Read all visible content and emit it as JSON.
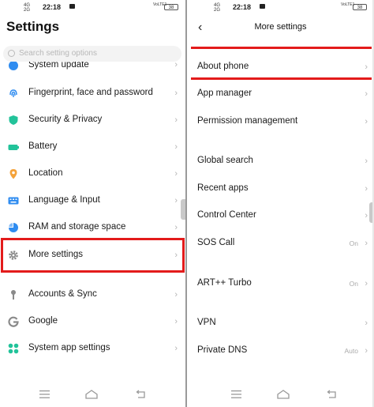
{
  "status": {
    "net_left": "4G\n2G",
    "time": "22:18",
    "signal": "VoLTE1",
    "battery": "38"
  },
  "left": {
    "title": "Settings",
    "search_placeholder": "Search setting options",
    "items": [
      {
        "label": "System update",
        "icon": "system-update-icon",
        "color": "#2f8cf0"
      },
      {
        "label": "Fingerprint, face and password",
        "icon": "fingerprint-icon",
        "color": "#2f8cf0"
      },
      {
        "label": "Security & Privacy",
        "icon": "shield-icon",
        "color": "#22c39a"
      },
      {
        "label": "Battery",
        "icon": "battery-icon",
        "color": "#22c39a"
      },
      {
        "label": "Location",
        "icon": "location-pin-icon",
        "color": "#f4a23a"
      },
      {
        "label": "Language & Input",
        "icon": "keyboard-icon",
        "color": "#2f8cf0"
      },
      {
        "label": "RAM and storage space",
        "icon": "storage-pie-icon",
        "color": "#2f8cf0"
      },
      {
        "label": "More settings",
        "icon": "gear-icon",
        "color": "#8a8a8a"
      },
      {
        "label": "Accounts & Sync",
        "icon": "account-key-icon",
        "color": "#8a8a8a"
      },
      {
        "label": "Google",
        "icon": "google-g-icon",
        "color": "#8a8a8a"
      },
      {
        "label": "System app settings",
        "icon": "apps-grid-icon",
        "color": "#22c39a"
      }
    ]
  },
  "right": {
    "title": "More settings",
    "items": [
      {
        "label": "About phone",
        "value": ""
      },
      {
        "label": "App manager",
        "value": ""
      },
      {
        "label": "Permission management",
        "value": ""
      },
      {
        "label": "Global search",
        "value": ""
      },
      {
        "label": "Recent apps",
        "value": ""
      },
      {
        "label": "Control Center",
        "value": ""
      },
      {
        "label": "SOS Call",
        "value": "On"
      },
      {
        "label": "ART++ Turbo",
        "value": "On"
      },
      {
        "label": "VPN",
        "value": ""
      },
      {
        "label": "Private DNS",
        "value": "Auto"
      }
    ]
  },
  "chevron": "›",
  "back_glyph": "‹",
  "highlight_color": "#e31b1b"
}
